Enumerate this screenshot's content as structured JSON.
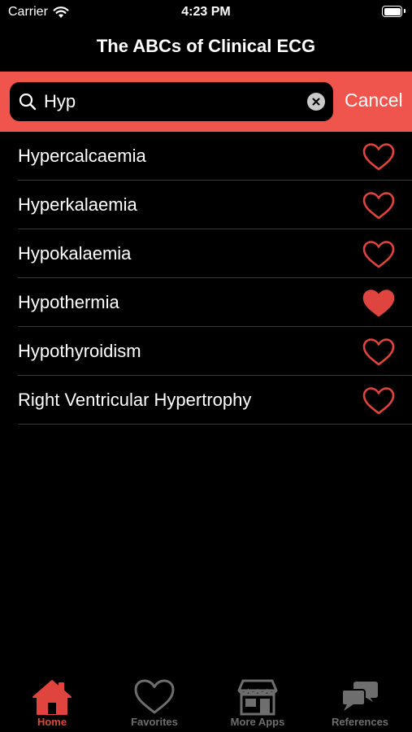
{
  "status_bar": {
    "carrier": "Carrier",
    "time": "4:23 PM"
  },
  "nav": {
    "title": "The ABCs of Clinical ECG"
  },
  "search": {
    "value": "Hyp",
    "cancel_label": "Cancel"
  },
  "results": [
    {
      "label": "Hypercalcaemia",
      "favorite": false
    },
    {
      "label": "Hyperkalaemia",
      "favorite": false
    },
    {
      "label": "Hypokalaemia",
      "favorite": false
    },
    {
      "label": "Hypothermia",
      "favorite": true
    },
    {
      "label": "Hypothyroidism",
      "favorite": false
    },
    {
      "label": "Right Ventricular Hypertrophy",
      "favorite": false
    }
  ],
  "tabs": [
    {
      "label": "Home",
      "icon": "home-icon",
      "active": true
    },
    {
      "label": "Favorites",
      "icon": "heart-icon",
      "active": false
    },
    {
      "label": "More Apps",
      "icon": "store-icon",
      "active": false
    },
    {
      "label": "References",
      "icon": "chat-bubbles-icon",
      "active": false
    }
  ],
  "colors": {
    "accent": "#f0554d",
    "heart": "#e0443e",
    "tab_inactive": "#6e6e6e",
    "background": "#000000"
  }
}
